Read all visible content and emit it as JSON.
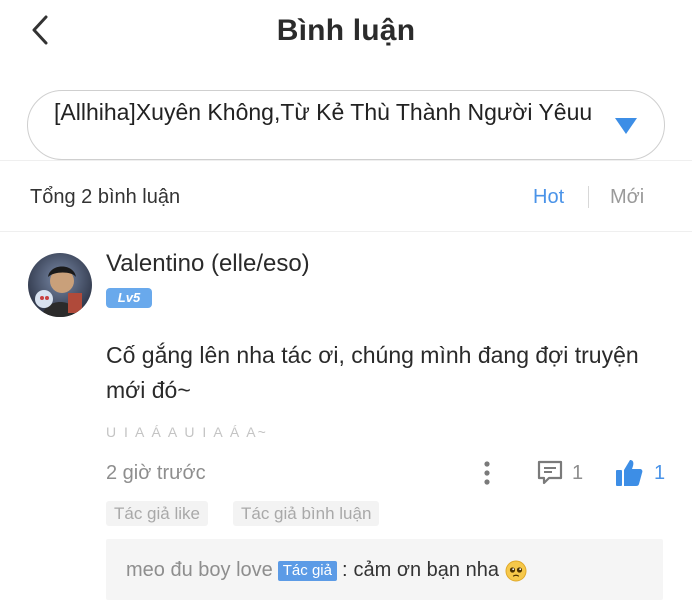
{
  "header": {
    "title": "Bình luận",
    "back_icon": "chevron-left-icon"
  },
  "story_selector": {
    "selected": "[Allhiha]Xuyên Không,Từ Kẻ Thù Thành Người Yêuu",
    "arrow_icon": "triangle-down-icon",
    "arrow_color": "#3d8ee6"
  },
  "comments_bar": {
    "total_label": "Tổng 2 bình luận",
    "sort_options": [
      "Hot",
      "Mới"
    ],
    "active_sort": "Hot",
    "active_color": "#4a93e8"
  },
  "comment": {
    "username": "Valentino (elle/eso)",
    "level": "Lv5",
    "text": "Cố gắng lên nha tác ơi, chúng mình đang đợi truyện mới đó~",
    "signature": "U I A Á A U I A Á A~",
    "time": "2 giờ trước",
    "reply_count": "1",
    "like_count": "1",
    "liked": true,
    "tags": [
      "Tác giả like",
      "Tác giả bình luận"
    ],
    "reply": {
      "author": "meo đu boy love",
      "author_badge": "Tác giả",
      "separator": ":",
      "text": "cảm ơn bạn nha",
      "emoji": "pleading-face-emoji"
    }
  }
}
